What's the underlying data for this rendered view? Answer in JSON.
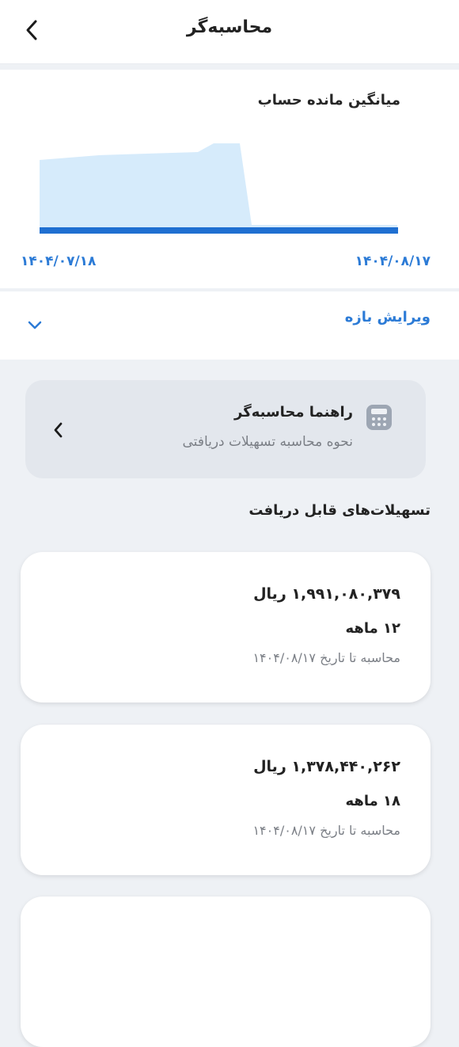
{
  "header": {
    "title": "محاسبه‌گر",
    "back_icon": "chevron-left-icon"
  },
  "chart": {
    "title": "میانگین مانده حساب",
    "start_date": "۱۴۰۴/۰۷/۱۸",
    "end_date": "۱۴۰۴/۰۸/۱۷"
  },
  "chart_data": {
    "type": "area",
    "title": "میانگین مانده حساب",
    "x": [
      "۱۴۰۴/۰۷/۱۸",
      "۱۴۰۴/۰۸/۱۷"
    ],
    "area_color": "#d6ebfb",
    "line_color": "#1f6fd1"
  },
  "range_edit": {
    "label": "ویرایش بازه",
    "icon": "chevron-down-icon"
  },
  "guide": {
    "title": "راهنما محاسبه‌گر",
    "subtitle": "نحوه محاسبه تسهیلات دریافتی",
    "icon": "calculator-icon",
    "arrow_icon": "chevron-left-icon"
  },
  "loans_section": {
    "title": "تسهیلات‌های قابل دریافت"
  },
  "loans": [
    {
      "amount": "۱,۹۹۱,۰۸۰,۳۷۹ ریال",
      "term": "۱۲ ماهه",
      "calc_date": "محاسبه تا تاریخ ۱۴۰۴/۰۸/۱۷"
    },
    {
      "amount": "۱,۳۷۸,۴۴۰,۲۶۲ ریال",
      "term": "۱۸ ماهه",
      "calc_date": "محاسبه تا تاریخ ۱۴۰۴/۰۸/۱۷"
    }
  ],
  "colors": {
    "accent": "#2c7bd6",
    "background": "#eef1f5"
  }
}
